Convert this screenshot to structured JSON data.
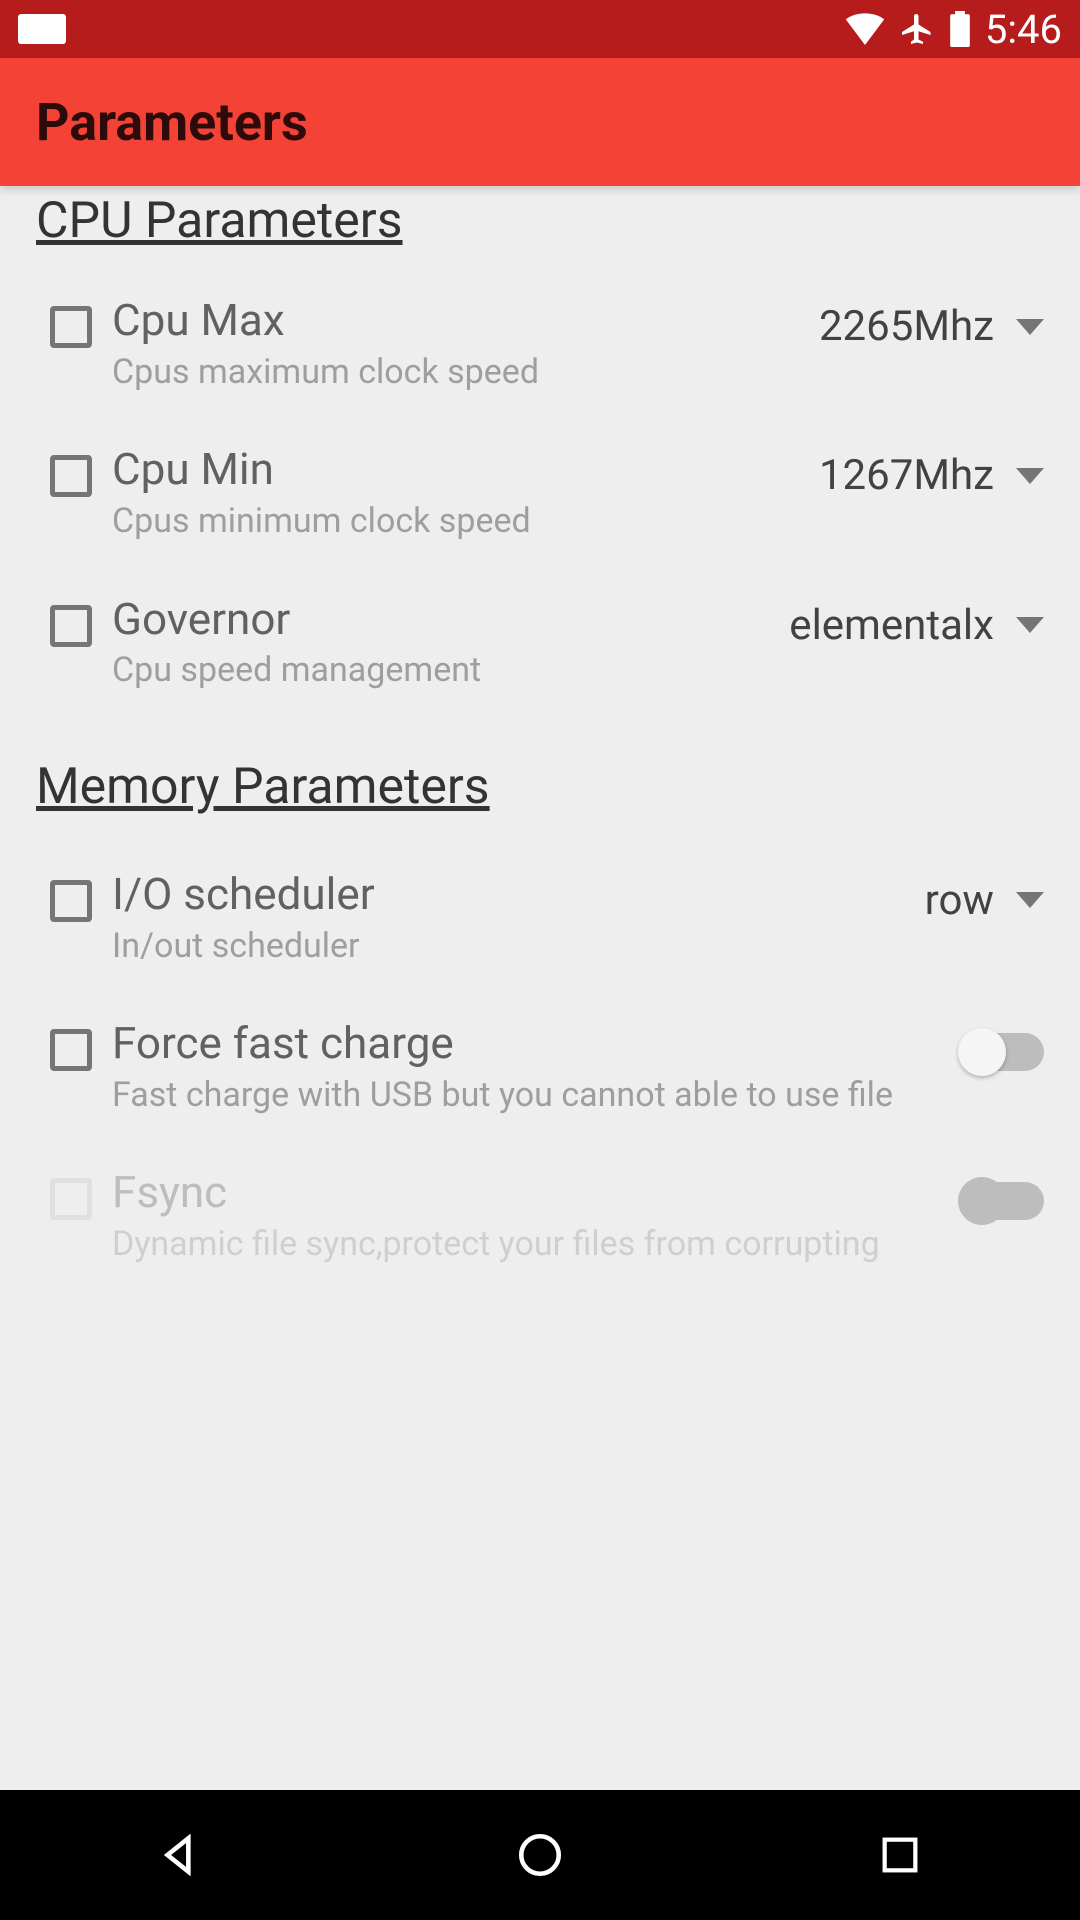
{
  "status": {
    "time": "5:46"
  },
  "appbar": {
    "title": "Parameters"
  },
  "sections": {
    "cpu_header": "CPU Parameters",
    "memory_header": "Memory Parameters"
  },
  "cpu": {
    "max": {
      "title": "Cpu Max",
      "sub": "Cpus maximum clock speed",
      "value": "2265Mhz"
    },
    "min": {
      "title": "Cpu Min",
      "sub": "Cpus minimum clock speed",
      "value": "1267Mhz"
    },
    "governor": {
      "title": "Governor",
      "sub": "Cpu speed management",
      "value": "elementalx"
    }
  },
  "memory": {
    "io": {
      "title": "I/O scheduler",
      "sub": "In/out scheduler",
      "value": "row"
    },
    "fastcharge": {
      "title": "Force fast charge",
      "sub": "Fast charge with USB but you cannot able to use file"
    },
    "fsync": {
      "title": "Fsync",
      "sub": "Dynamic file sync,protect your files from corrupting"
    }
  }
}
